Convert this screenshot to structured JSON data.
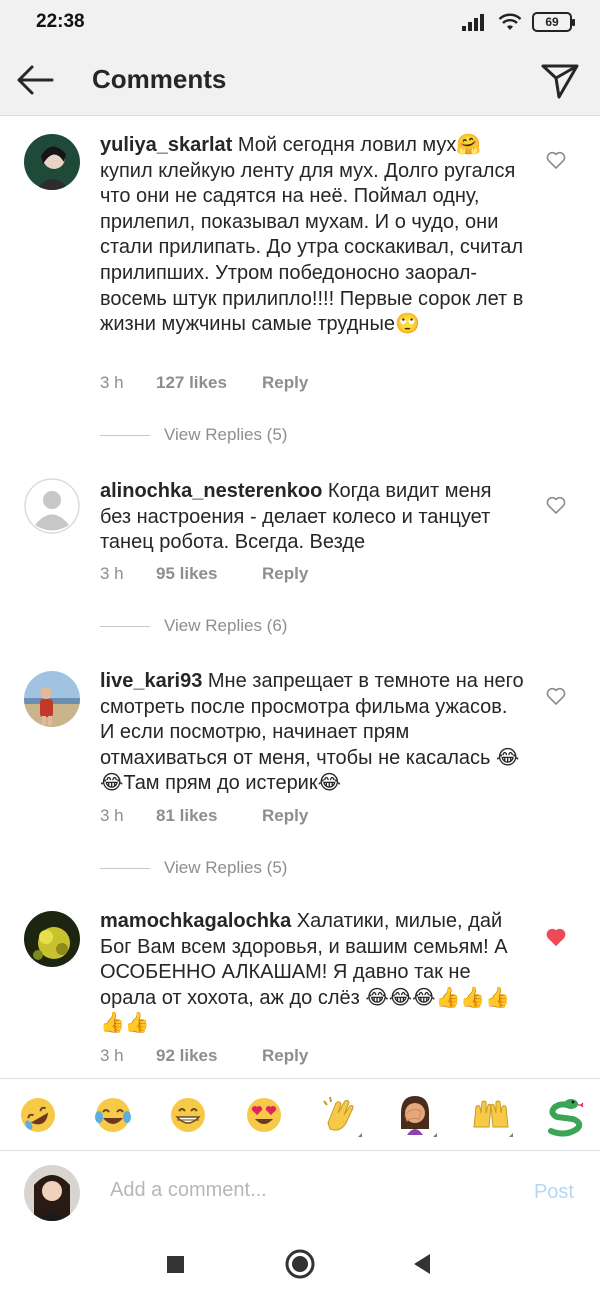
{
  "status": {
    "time": "22:38",
    "battery": "69"
  },
  "header": {
    "title": "Comments"
  },
  "comments": [
    {
      "username": "yuliya_skarlat",
      "text": "Мой сегодня ловил мух🤗 купил клейкую ленту для мух. Долго ругался что они не садятся на неё. Поймал одну, прилепил, показывал мухам. И о чудо, они стали прилипать. До утра соскакивал, считал прилипших. Утром победоносно заорал- восемь штук прилипло!!!! Первые сорок лет в жизни мужчины самые трудные🙄",
      "time": "3 h",
      "likes": "127 likes",
      "reply": "Reply",
      "replies": "View Replies (5)",
      "liked": false
    },
    {
      "username": "alinochka_nesterenkoo",
      "text": "Когда видит меня без настроения - делает колесо и танцует танец робота. Всегда. Везде",
      "time": "3 h",
      "likes": "95 likes",
      "reply": "Reply",
      "replies": "View Replies (6)",
      "liked": false
    },
    {
      "username": "live_kari93",
      "text": "Мне запрещает в темноте на него смотреть после просмотра фильма ужасов. И если посмотрю, начинает прям отмахиваться от меня, чтобы не касалась 😂😂Там прям до истерик😂",
      "time": "3 h",
      "likes": "81 likes",
      "reply": "Reply",
      "replies": "View Replies (5)",
      "liked": false
    },
    {
      "username": "mamochkagalochka",
      "text": "Халатики, милые, дай Бог Вам всем здоровья, и вашим семьям! А ОСОБЕННО АЛКАШАМ! Я давно так не орала от хохота, аж до слёз 😂😂😂👍👍👍👍👍",
      "time": "3 h",
      "likes": "92 likes",
      "reply": "Reply",
      "liked": true
    }
  ],
  "emoji_bar": [
    "rolling-on-floor-laughing",
    "tears-of-joy",
    "grinning-face",
    "heart-eyes",
    "clapping-hands",
    "woman-facepalming",
    "raising-hands",
    "snake"
  ],
  "compose": {
    "placeholder": "Add a comment...",
    "post_label": "Post"
  },
  "colors": {
    "accent_blue": "#b3d8f5",
    "like_red": "#ed4956",
    "meta_gray": "#8e8e8e"
  }
}
